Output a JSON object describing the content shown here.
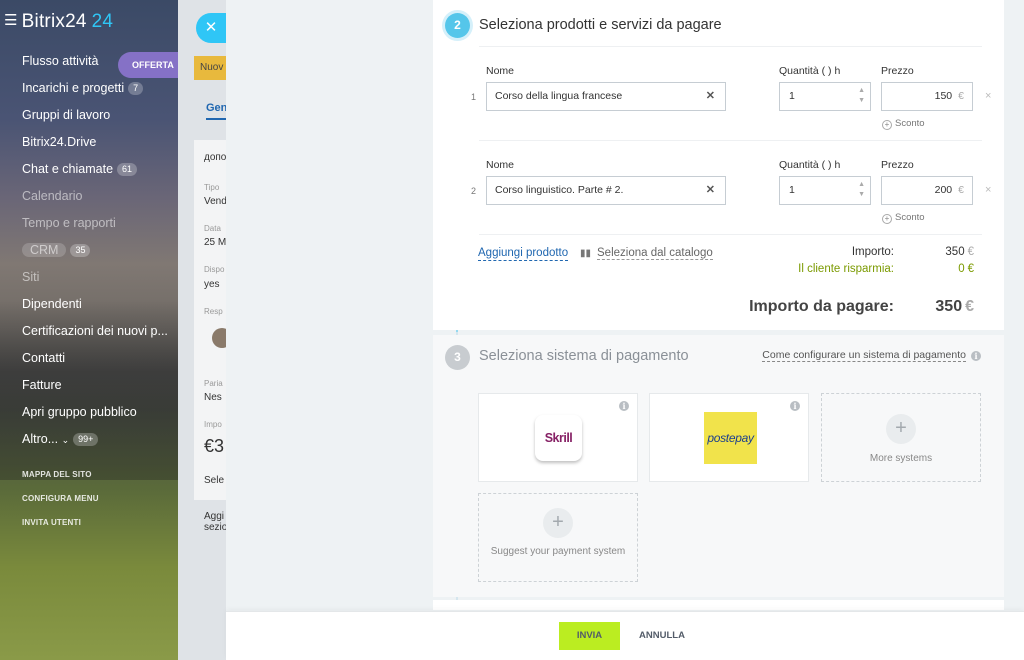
{
  "sidebar": {
    "logo_text": "Bitrix24",
    "logo_num": "24",
    "offer_label": "OFFERTA",
    "items": [
      {
        "label": "Flusso attività",
        "count": ""
      },
      {
        "label": "Incarichi e progetti",
        "count": "7"
      },
      {
        "label": "Gruppi di lavoro",
        "count": ""
      },
      {
        "label": "Bitrix24.Drive",
        "count": ""
      },
      {
        "label": "Chat e chiamate",
        "count": "61"
      },
      {
        "label": "Calendario",
        "count": ""
      },
      {
        "label": "Tempo e rapporti",
        "count": ""
      },
      {
        "label": "CRM",
        "count": "35"
      },
      {
        "label": "Siti",
        "count": ""
      },
      {
        "label": "Dipendenti",
        "count": ""
      },
      {
        "label": "Certificazioni dei nuovi p...",
        "count": ""
      },
      {
        "label": "Contatti",
        "count": ""
      },
      {
        "label": "Fatture",
        "count": ""
      },
      {
        "label": "Apri gruppo pubblico",
        "count": ""
      },
      {
        "label": "Altro...",
        "count": "99+"
      }
    ],
    "small_links": [
      "MAPPA DEL SITO",
      "CONFIGURA MENU",
      "INVITA UTENTI"
    ]
  },
  "background_page": {
    "new_button": "Nuov",
    "tab": "Gen",
    "lines": [
      "дополн",
      "Tipo",
      "Vend",
      "Data",
      "25 M",
      "Dispo",
      "yes",
      "Resp",
      "Paria",
      "Nes",
      "Impo",
      "€3",
      "Sele",
      "Aggi",
      "sezio"
    ]
  },
  "section2": {
    "step": "2",
    "title": "Seleziona prodotti e servizi da pagare",
    "col_name": "Nome",
    "col_qty": "Quantità ( ) h",
    "col_price": "Prezzo",
    "discount_label": "Sconto",
    "currency": "€",
    "products": [
      {
        "index": "1",
        "name": "Corso della lingua francese",
        "qty": "1",
        "price": "150"
      },
      {
        "index": "2",
        "name": "Corso linguistico. Parte # 2.",
        "qty": "1",
        "price": "200"
      }
    ],
    "add_product": "Aggiungi prodotto",
    "from_catalog": "Seleziona dal catalogo",
    "amount_label": "Importo:",
    "amount_value": "350",
    "savings_label": "Il cliente risparmia:",
    "savings_value": "0",
    "total_label": "Importo da pagare:",
    "total_value": "350"
  },
  "section3": {
    "step": "3",
    "title": "Seleziona sistema di pagamento",
    "howto_link": "Come configurare un sistema di pagamento",
    "skrill_label": "Skrill",
    "postepay_label": "postepay",
    "more_systems": "More systems",
    "suggest": "Suggest your payment system"
  },
  "footer": {
    "send": "INVIA",
    "cancel": "ANNULLA"
  },
  "colors": {
    "accent_blue": "#2fc6f6",
    "link_blue": "#2067b0",
    "send_green": "#bbed21",
    "savings_green": "#7b9a00"
  }
}
